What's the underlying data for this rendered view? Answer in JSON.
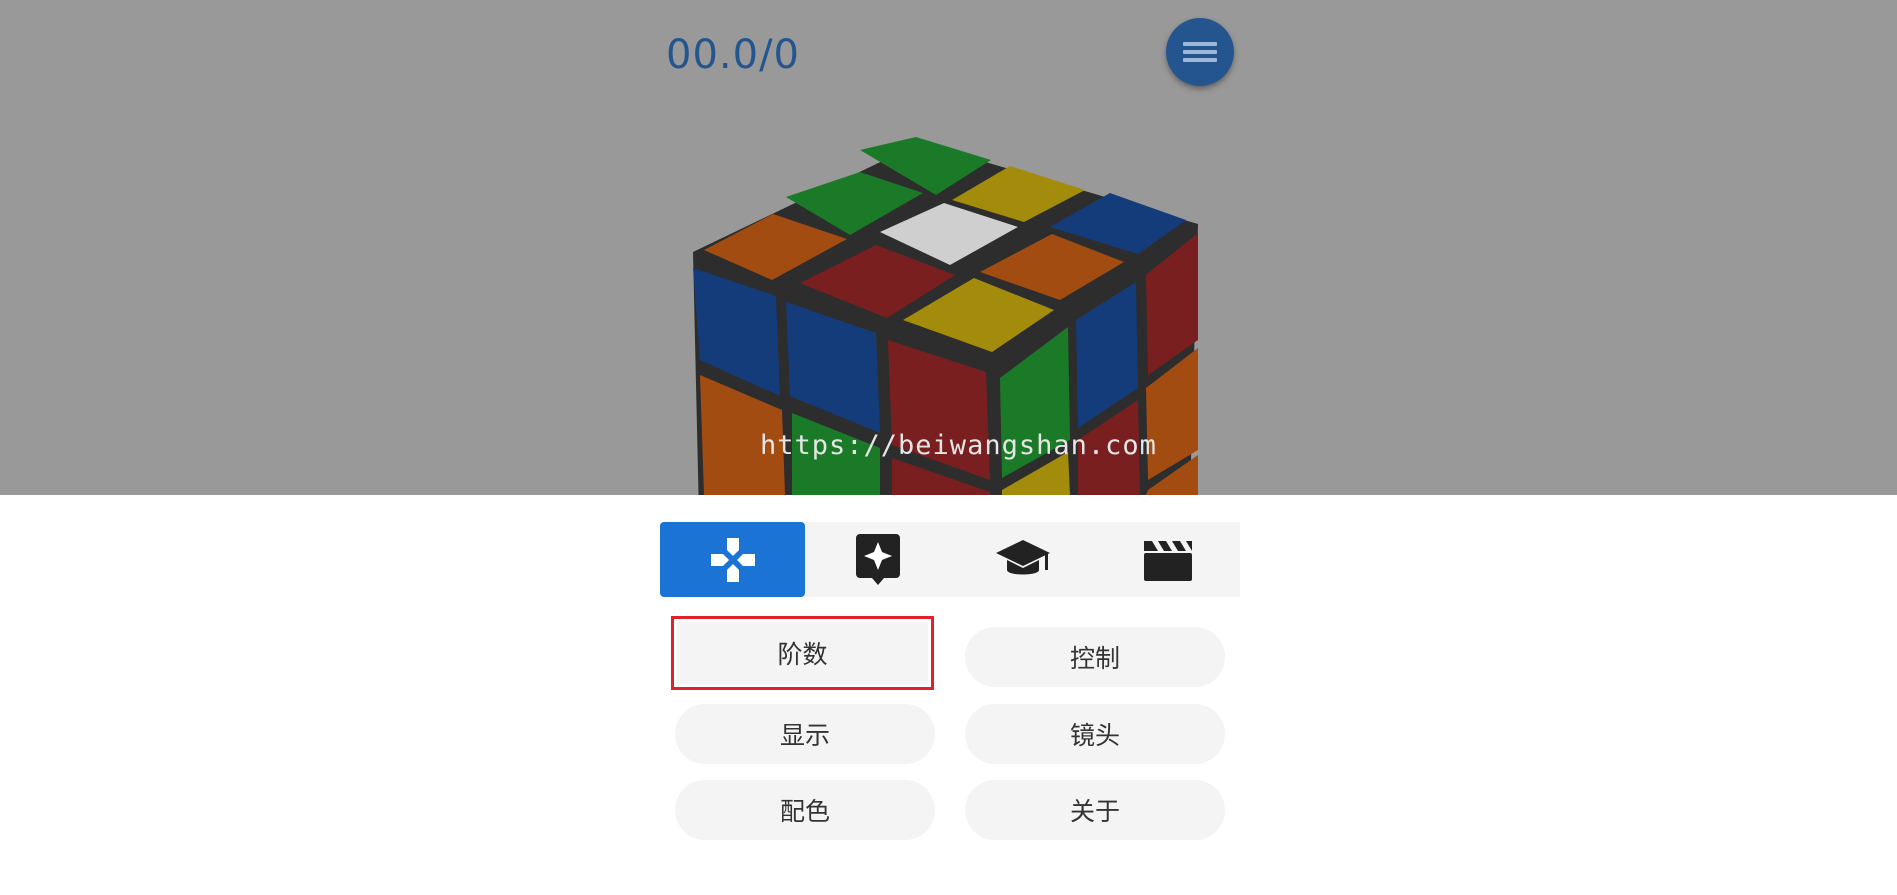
{
  "timer": "00.0/0",
  "watermark": "https://beiwangshan.com",
  "tabs": [
    {
      "icon": "gamepad-icon",
      "active": true
    },
    {
      "icon": "sparkle-chat-icon",
      "active": false
    },
    {
      "icon": "graduation-cap-icon",
      "active": false
    },
    {
      "icon": "clapperboard-icon",
      "active": false
    }
  ],
  "buttons": {
    "order": "阶数",
    "control": "控制",
    "display": "显示",
    "camera": "镜头",
    "colors": "配色",
    "about": "关于"
  },
  "colors": {
    "accent": "#1b73d6",
    "timer": "#23558f",
    "highlight_border": "#e0202a"
  }
}
